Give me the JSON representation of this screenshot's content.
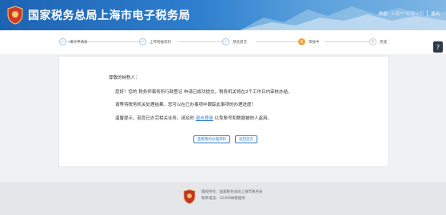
{
  "header": {
    "title": "国家税务总局上海市电子税务局",
    "welcome": "欢迎",
    "company": "上海***有限公司",
    "logout": "退出"
  },
  "steps": [
    {
      "num": "✓",
      "label": "填写申请表"
    },
    {
      "num": "✓",
      "label": "上传附报资料"
    },
    {
      "num": "✓",
      "label": "预览提交"
    },
    {
      "num": "4",
      "label": "审核中"
    },
    {
      "num": "5",
      "label": "完成"
    }
  ],
  "help": {
    "icon": "?"
  },
  "notice": {
    "greeting": "尊敬的纳税人：",
    "line1": "您好！您的 税务师事务所行政登记 申请已成功提交，税务机关将在2个工作日内审核办结，",
    "line2": "请等待税务机关处理结果。您可以在已办事项中跟踪此事项的办理进度！",
    "line3_prefix": "温馨提示，若您已办完相关业务，请及时",
    "line3_link": "退出登录",
    "line3_suffix": "以免账号和数据被他人盗用。",
    "btn_view": "查看我的办理资料",
    "btn_back": "返回首页"
  },
  "footer": {
    "line1": "版权所有：国家税务总局上海市税务局",
    "line2": "联系电话：12366纳税服务"
  },
  "colors": {
    "header_blue": "#1d63b3",
    "accent_blue": "#2f7fce",
    "active_step": "#f0a540"
  }
}
